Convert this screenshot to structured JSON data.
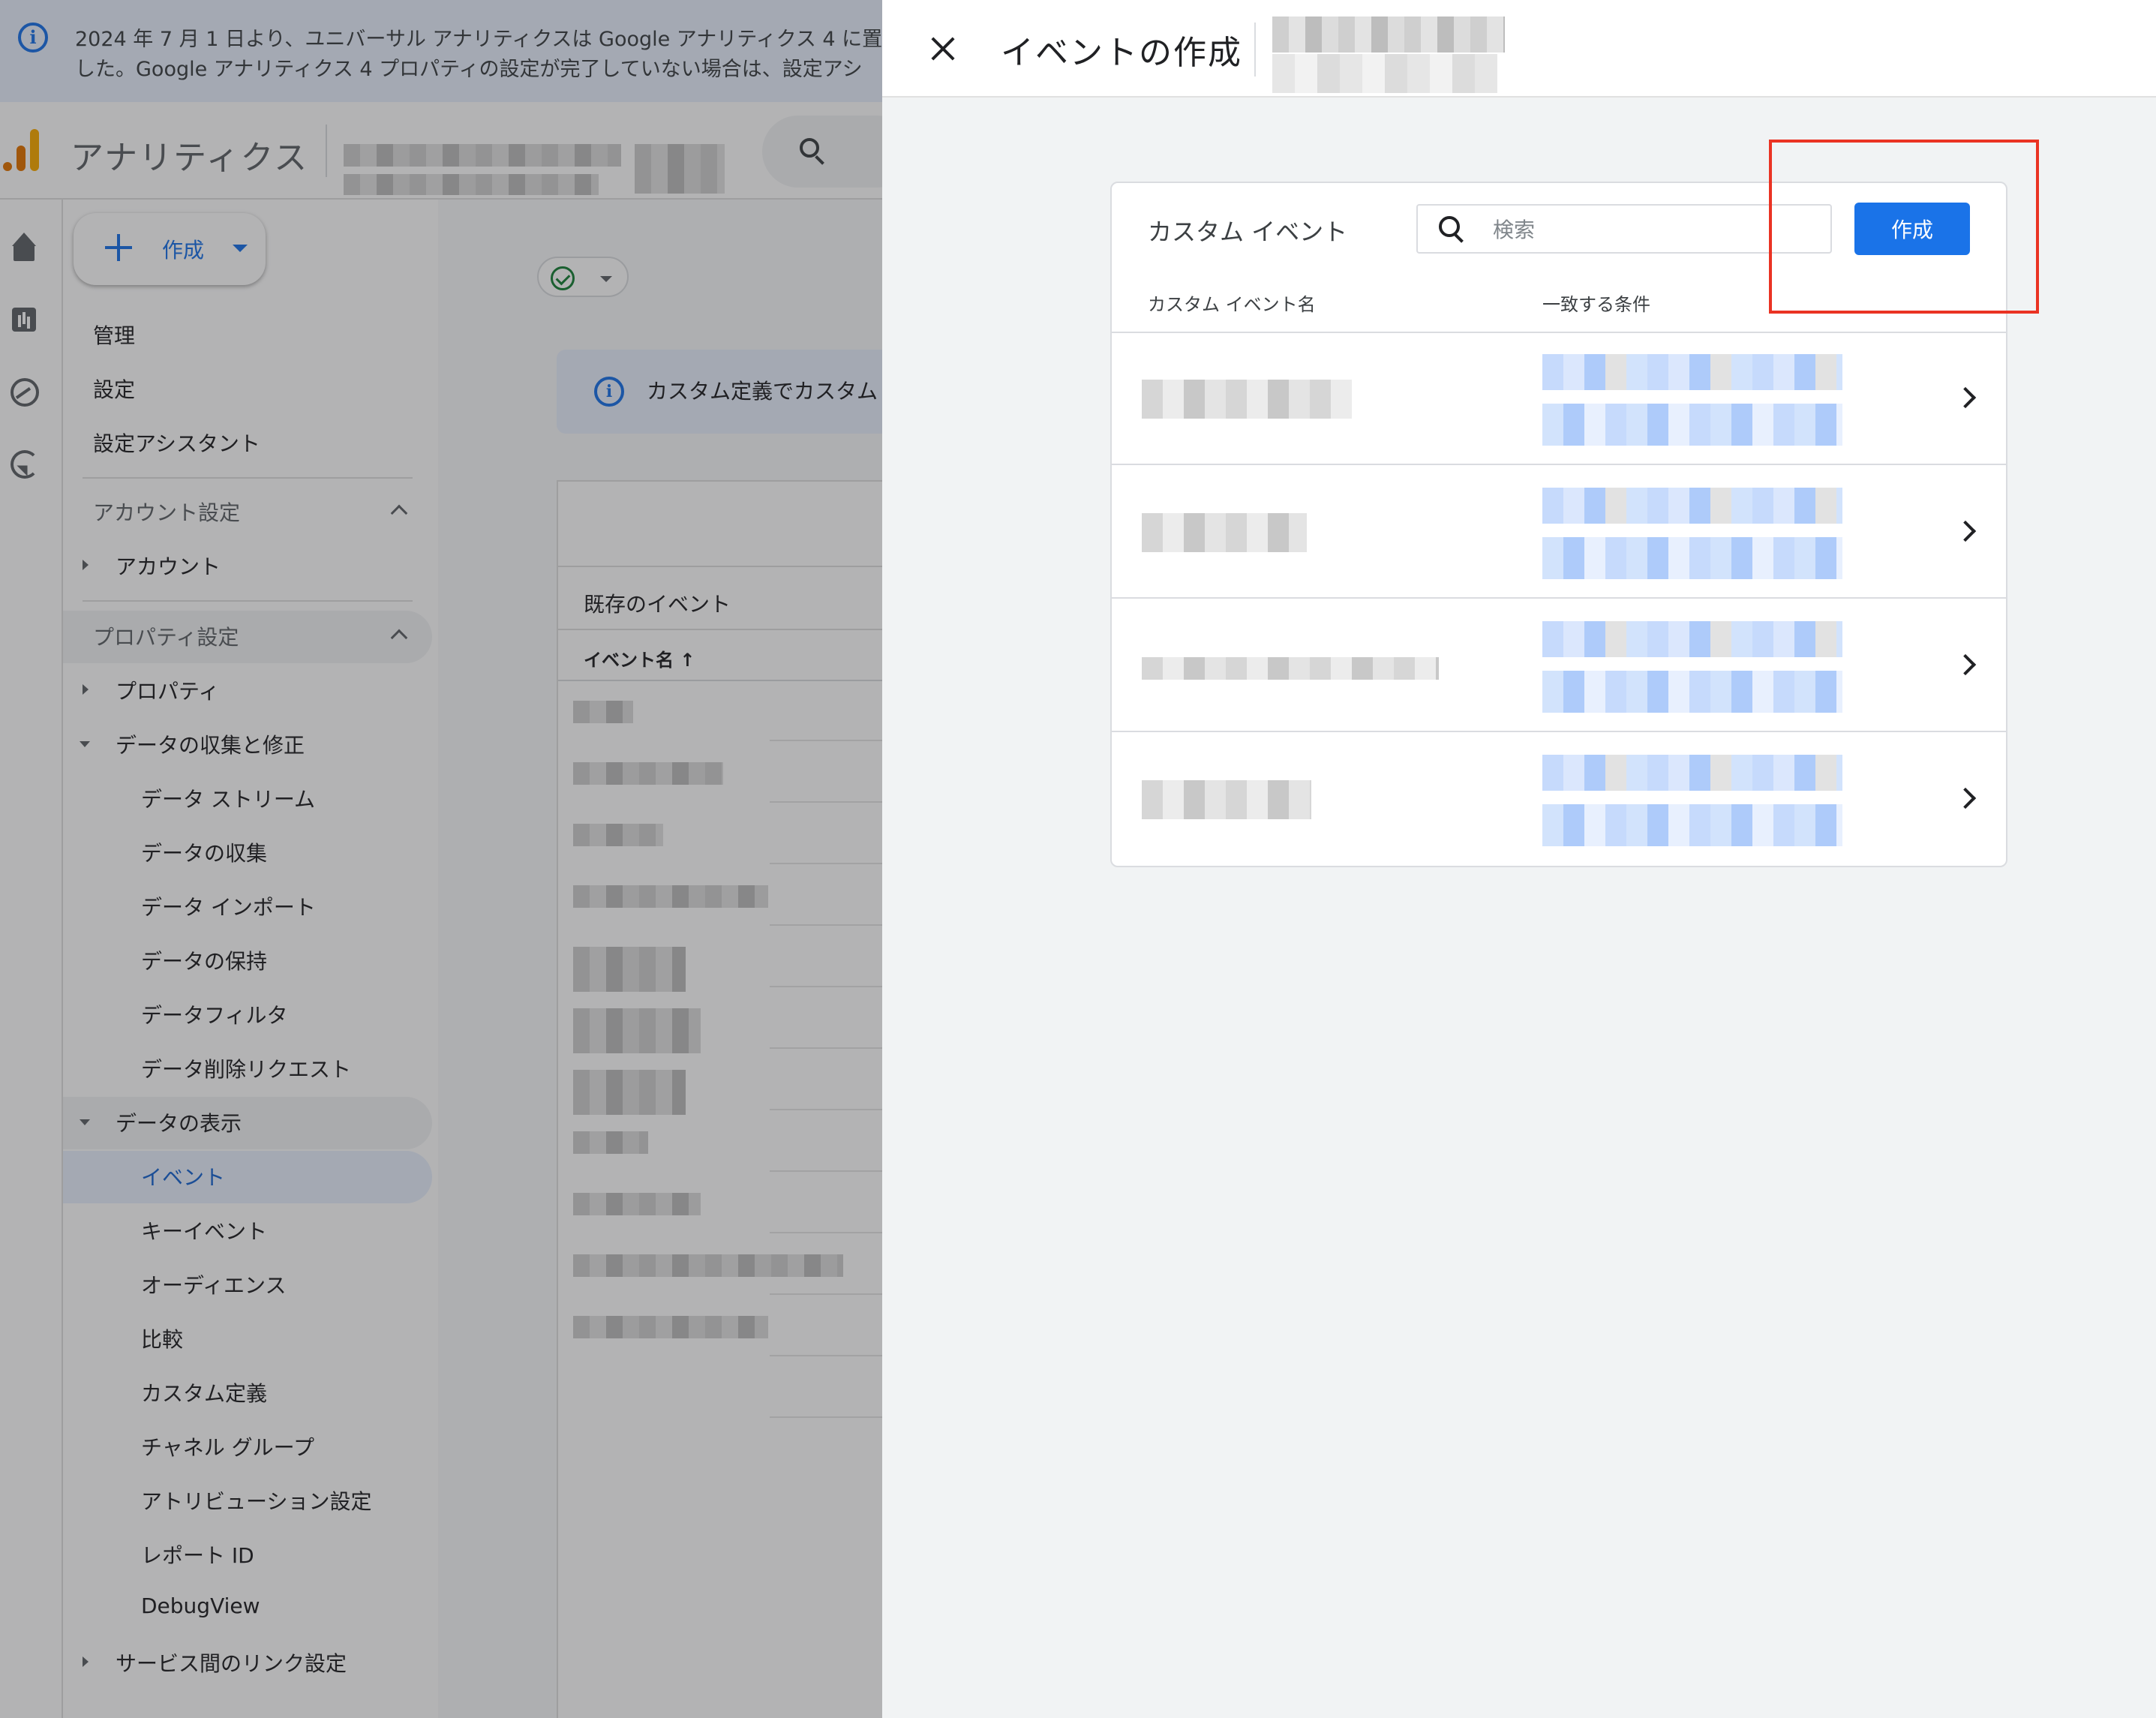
{
  "banner": {
    "line1": "2024 年 7 月 1 日より、ユニバーサル アナリティクスは Google アナリティクス 4 に置",
    "line2": "した。Google アナリティクス 4 プロパティの設定が完了していない場合は、設定アシ"
  },
  "topbar": {
    "app_title": "アナリティクス",
    "search_hint": "「"
  },
  "sidebar": {
    "create_label": "作成",
    "items": {
      "admin": "管理",
      "settings": "設定",
      "setup_assistant": "設定アシスタント",
      "account_settings": "アカウント設定",
      "account": "アカウント",
      "property_settings": "プロパティ設定",
      "property": "プロパティ",
      "data_collection_modification": "データの収集と修正",
      "data_streams": "データ ストリーム",
      "data_collection": "データの収集",
      "data_import": "データ インポート",
      "data_retention": "データの保持",
      "data_filters": "データフィルタ",
      "data_deletion_requests": "データ削除リクエスト",
      "data_display": "データの表示",
      "events": "イベント",
      "key_events": "キーイベント",
      "audiences": "オーディエンス",
      "comparisons": "比較",
      "custom_definitions": "カスタム定義",
      "channel_groups": "チャネル グループ",
      "attribution_settings": "アトリビューション設定",
      "report_id": "レポート ID",
      "debugview": "DebugView",
      "product_links": "サービス間のリンク設定"
    }
  },
  "main": {
    "info_text": "カスタム定義でカスタム",
    "existing_events_title": "既存のイベント",
    "event_name_column": "イベント名 ↑"
  },
  "panel": {
    "title": "イベントの作成",
    "card": {
      "title": "カスタム イベント",
      "search_placeholder": "検索",
      "create_button": "作成",
      "columns": {
        "name": "カスタム イベント名",
        "condition": "一致する条件"
      }
    }
  },
  "colors": {
    "primary": "#1a73e8",
    "highlight_box": "#ea3323",
    "logo_orange": "#e37400",
    "logo_yellow": "#f9ab00"
  }
}
